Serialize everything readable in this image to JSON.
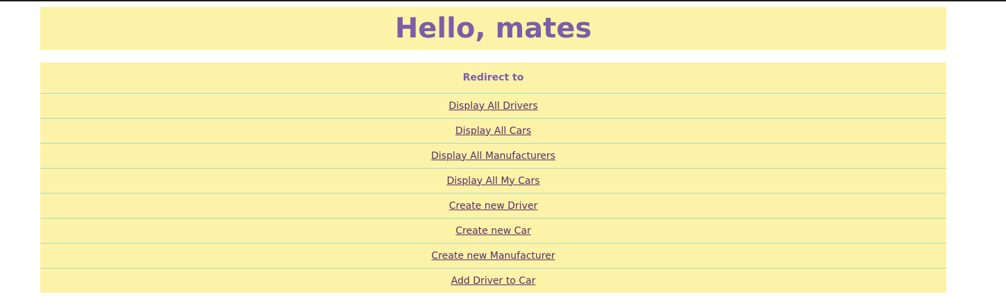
{
  "header": {
    "title": "Hello, mates"
  },
  "nav": {
    "heading": "Redirect to",
    "links": [
      "Display All Drivers",
      "Display All Cars",
      "Display All Manufacturers",
      "Display All My Cars",
      "Create new Driver",
      "Create new Car",
      "Create new Manufacturer",
      "Add Driver to Car"
    ]
  },
  "colors": {
    "panel_background": "#fdf3a8",
    "title_text": "#7b5ea7",
    "link_text": "#5a2a66",
    "row_divider": "#9fdcc7"
  }
}
